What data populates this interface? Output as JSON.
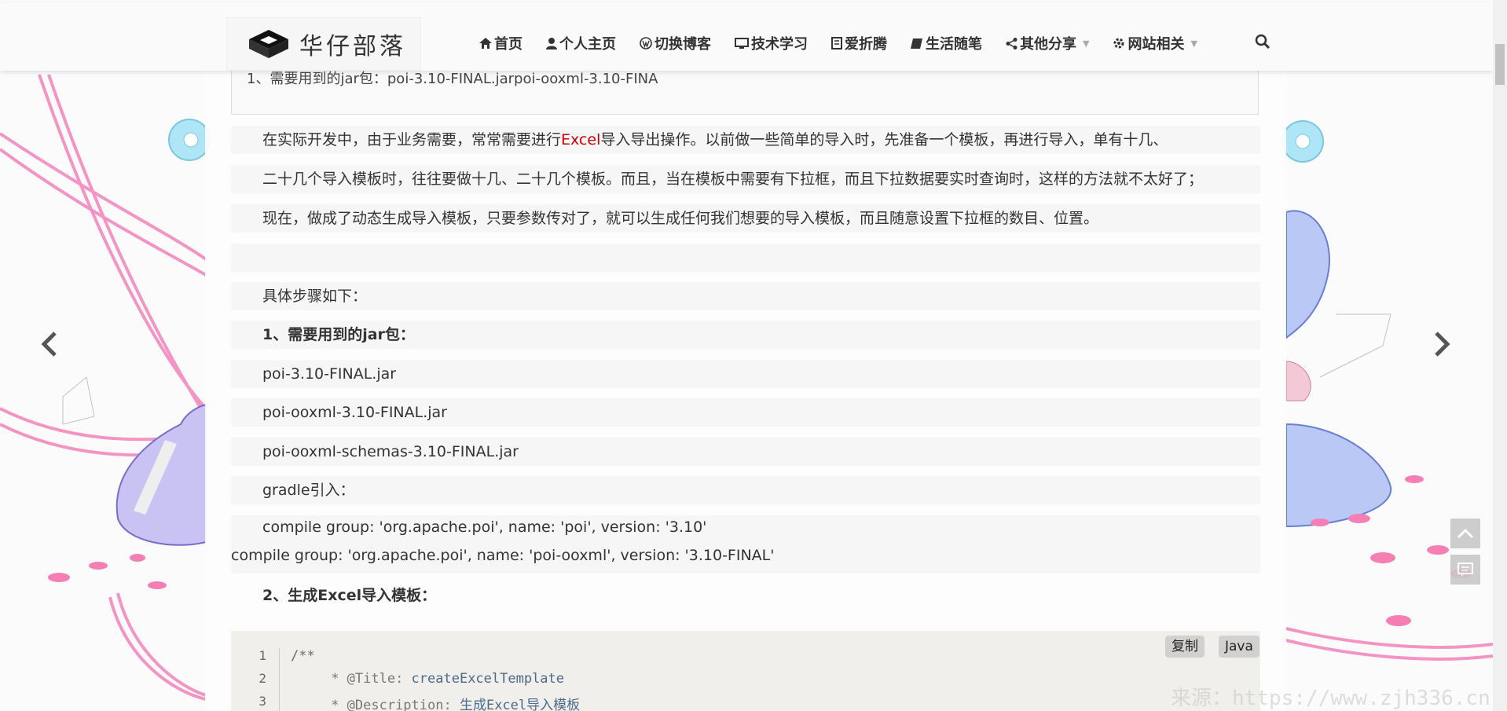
{
  "site": {
    "logo_text": "华仔部落"
  },
  "nav": {
    "items": [
      {
        "label": "首页",
        "icon": "home-icon"
      },
      {
        "label": "个人主页",
        "icon": "user-icon"
      },
      {
        "label": "切换博客",
        "icon": "wordpress-icon"
      },
      {
        "label": "技术学习",
        "icon": "desktop-icon"
      },
      {
        "label": "爱折腾",
        "icon": "book-icon"
      },
      {
        "label": "生活随笔",
        "icon": "notebook-icon"
      },
      {
        "label": "其他分享",
        "icon": "share-icon",
        "dropdown": true
      },
      {
        "label": "网站相关",
        "icon": "gear-icon",
        "dropdown": true
      }
    ]
  },
  "article": {
    "summary": "1、需要用到的jar包：poi-3.10-FINAL.jarpoi-ooxml-3.10-FINA",
    "intro_1_pre": "在实际开发中，由于业务需要，常常需要进行",
    "intro_1_excel": "Excel",
    "intro_1_post": "导入导出操作。以前做一些简单的导入时，先准备一个模板，再进行导入，单有十几、",
    "intro_2": "二十几个导入模板时，往往要做十几、二十几个模板。而且，当在模板中需要有下拉框，而且下拉数据要实时查询时，这样的方法就不太好了；",
    "intro_3": "现在，做成了动态生成导入模板，只要参数传对了，就可以生成任何我们想要的导入模板，而且随意设置下拉框的数目、位置。",
    "steps_intro": "具体步骤如下：",
    "step1_title": "1、需要用到的jar包：",
    "jar1": "poi-3.10-FINAL.jar",
    "jar2": "poi-ooxml-3.10-FINAL.jar",
    "jar3": "poi-ooxml-schemas-3.10-FINAL.jar",
    "gradle_label": "gradle引入：",
    "gradle_line1": "compile group: 'org.apache.poi', name: 'poi', version: '3.10'",
    "gradle_line2": "compile group: 'org.apache.poi', name: 'poi-ooxml', version: '3.10-FINAL'",
    "step2_title": "2、生成Excel导入模板："
  },
  "code": {
    "copy_label": "复制",
    "lang_label": "Java",
    "line_numbers": [
      "1",
      "2",
      "3"
    ],
    "line1": "/**",
    "line2_tag": "* @Title: ",
    "line2_val": "createExcelTemplate",
    "line3_tag": "* @Description: ",
    "line3_val": "生成Excel导入模板"
  },
  "watermark": "来源：https://www.zjh336.cn"
}
